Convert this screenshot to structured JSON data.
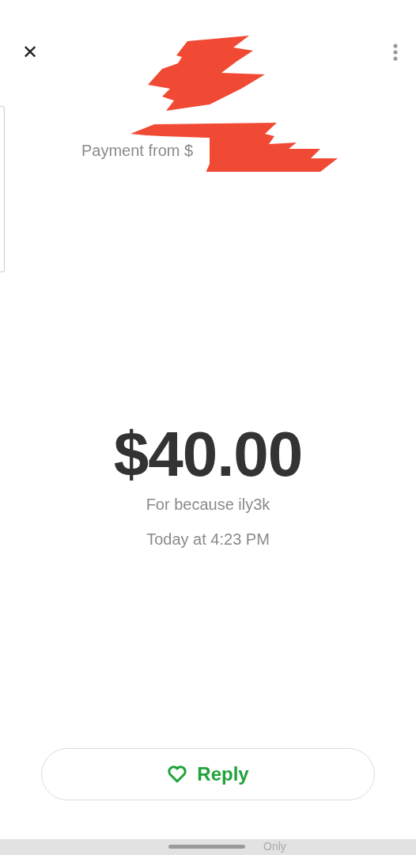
{
  "header": {
    "close": "✕"
  },
  "payment": {
    "title": "Payment from $",
    "amount": "$40.00",
    "note": "For because ily3k",
    "time": "Today at 4:23 PM"
  },
  "reply_button": {
    "label": "Reply"
  },
  "bottom_bar": {
    "text": "Only"
  }
}
